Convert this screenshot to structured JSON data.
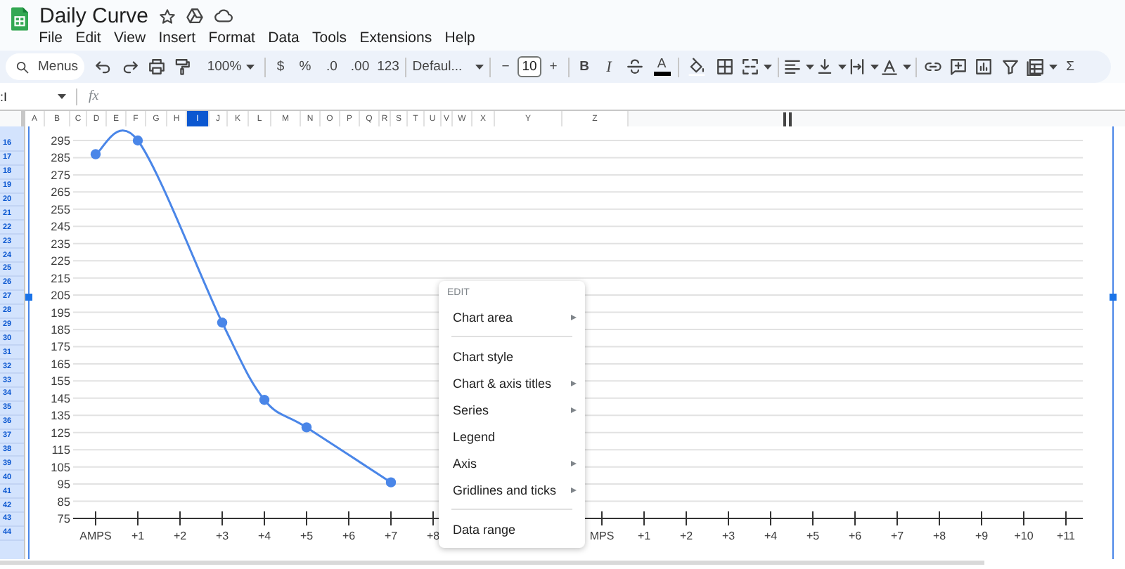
{
  "document": {
    "title": "Daily Curve"
  },
  "menu_bar": [
    "File",
    "Edit",
    "View",
    "Insert",
    "Format",
    "Data",
    "Tools",
    "Extensions",
    "Help"
  ],
  "toolbar": {
    "search_placeholder": "Menus",
    "zoom": "100%",
    "currency": "$",
    "percent": "%",
    "decrease_decimals": ".0",
    "increase_decimals": ".00",
    "number_format": "123",
    "font": "Defaul...",
    "font_size_decrease": "−",
    "font_size": "10",
    "font_size_increase": "+",
    "bold": "B",
    "italic": "I",
    "text_color": "A",
    "functions": "Σ"
  },
  "formula_bar": {
    "name_box": ":I",
    "fx": "fx"
  },
  "columns": [
    {
      "label": "A",
      "selected": false
    },
    {
      "label": "B",
      "selected": false
    },
    {
      "label": "C",
      "selected": false
    },
    {
      "label": "D",
      "selected": false
    },
    {
      "label": "E",
      "selected": false
    },
    {
      "label": "F",
      "selected": false
    },
    {
      "label": "G",
      "selected": false
    },
    {
      "label": "H",
      "selected": false
    },
    {
      "label": "I",
      "selected": true
    },
    {
      "label": "J",
      "selected": false
    },
    {
      "label": "K",
      "selected": false
    },
    {
      "label": "L",
      "selected": false
    },
    {
      "label": "M",
      "selected": false
    },
    {
      "label": "N",
      "selected": false
    },
    {
      "label": "O",
      "selected": false
    },
    {
      "label": "P",
      "selected": false
    },
    {
      "label": "Q",
      "selected": false
    },
    {
      "label": "R",
      "selected": false
    },
    {
      "label": "S",
      "selected": false
    },
    {
      "label": "T",
      "selected": false
    },
    {
      "label": "U",
      "selected": false
    },
    {
      "label": "V",
      "selected": false
    },
    {
      "label": "W",
      "selected": false
    },
    {
      "label": "X",
      "selected": false
    },
    {
      "label": "Y",
      "selected": false
    },
    {
      "label": "Z",
      "selected": false
    }
  ],
  "rows": [
    {
      "label": "16",
      "selected": true
    },
    {
      "label": "17",
      "selected": true
    },
    {
      "label": "18",
      "selected": true
    },
    {
      "label": "19",
      "selected": true
    },
    {
      "label": "20",
      "selected": true
    },
    {
      "label": "21",
      "selected": true
    },
    {
      "label": "22",
      "selected": true
    },
    {
      "label": "23",
      "selected": true
    },
    {
      "label": "24",
      "selected": true
    },
    {
      "label": "25",
      "selected": true
    },
    {
      "label": "26",
      "selected": true
    },
    {
      "label": "27",
      "selected": true
    },
    {
      "label": "28",
      "selected": true
    },
    {
      "label": "29",
      "selected": true
    },
    {
      "label": "30",
      "selected": true
    },
    {
      "label": "31",
      "selected": true
    },
    {
      "label": "32",
      "selected": true
    },
    {
      "label": "33",
      "selected": true
    },
    {
      "label": "34",
      "selected": true
    },
    {
      "label": "35",
      "selected": true
    },
    {
      "label": "36",
      "selected": true
    },
    {
      "label": "37",
      "selected": true
    },
    {
      "label": "38",
      "selected": true
    },
    {
      "label": "39",
      "selected": true
    },
    {
      "label": "40",
      "selected": true
    },
    {
      "label": "41",
      "selected": true
    },
    {
      "label": "42",
      "selected": true
    },
    {
      "label": "43",
      "selected": true
    },
    {
      "label": "44",
      "selected": true
    }
  ],
  "chart": {
    "chart_data": {
      "type": "line",
      "categories": [
        "AMPS",
        "+1",
        "+2",
        "+3",
        "+4",
        "+5",
        "+6",
        "+7",
        "+8",
        null,
        null,
        null,
        "MPS",
        "+1",
        "+2",
        "+3",
        "+4",
        "+5",
        "+6",
        "+7",
        "+8",
        "+9",
        "+10",
        "+11"
      ],
      "grid": true,
      "series": [
        {
          "color": "#4a86e8",
          "marker": true,
          "values": [
            287,
            295,
            null,
            189,
            144,
            128,
            null,
            96,
            null,
            null,
            null,
            null,
            null,
            null,
            null,
            null,
            null,
            null,
            null,
            null,
            null,
            null,
            null,
            null
          ]
        }
      ],
      "ylim": [
        75,
        295
      ],
      "yticks": [
        75,
        85,
        95,
        105,
        115,
        125,
        135,
        145,
        155,
        165,
        175,
        185,
        195,
        205,
        215,
        225,
        235,
        245,
        255,
        265,
        275,
        285,
        295
      ]
    }
  },
  "context_menu": {
    "header": "EDIT",
    "items": [
      {
        "kind": "item",
        "label": "Chart area",
        "submenu": true
      },
      {
        "kind": "divider"
      },
      {
        "kind": "item",
        "label": "Chart style",
        "submenu": false
      },
      {
        "kind": "item",
        "label": "Chart & axis titles",
        "submenu": true
      },
      {
        "kind": "item",
        "label": "Series",
        "submenu": true
      },
      {
        "kind": "item",
        "label": "Legend",
        "submenu": false
      },
      {
        "kind": "item",
        "label": "Axis",
        "submenu": true
      },
      {
        "kind": "item",
        "label": "Gridlines and ticks",
        "submenu": true
      },
      {
        "kind": "divider"
      },
      {
        "kind": "item",
        "label": "Data range",
        "submenu": false
      }
    ]
  }
}
